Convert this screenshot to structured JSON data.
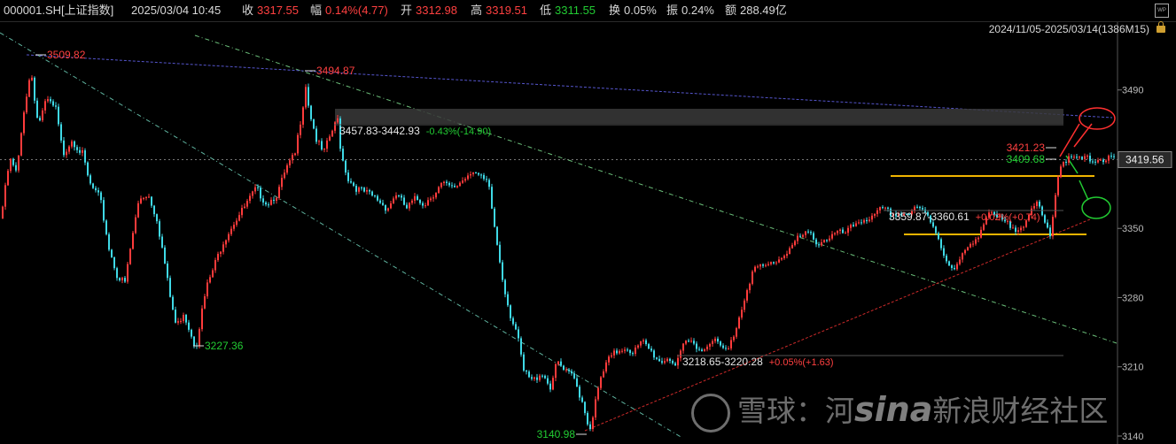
{
  "header": {
    "symbol": "000001.SH[上证指数]",
    "datetime": "2025/03/04 10:45",
    "close_label": "收",
    "close_value": "3317.55",
    "amp_label": "幅",
    "amp_value": "0.14%(4.77)",
    "open_label": "开",
    "open_value": "3312.98",
    "high_label": "高",
    "high_value": "3319.51",
    "low_label": "低",
    "low_value": "3311.55",
    "turnover_label": "换",
    "turnover_value": "0.05%",
    "swing_label": "振",
    "swing_value": "0.24%",
    "amount_label": "额",
    "amount_value": "288.49亿",
    "range": "2024/11/05-2025/03/14(1386M15)"
  },
  "watermark": {
    "brand1": "雪球：河",
    "brand2": "sina",
    "brand3": "新浪财经社区"
  },
  "colors": {
    "up": "#ff3b3b",
    "down": "#3fd9e6",
    "background": "#000000",
    "channel": "#f0b400"
  },
  "chart_data": {
    "type": "candlestick",
    "interval": "15M",
    "ylim": [
      3140,
      3530
    ],
    "yticks": [
      3140,
      3210,
      3280,
      3350,
      3420,
      3490
    ],
    "current_price": "3419.56",
    "pivots": [
      {
        "label": "3509.82",
        "value": 3509.82,
        "kind": "high"
      },
      {
        "label": "3494.87",
        "value": 3494.87,
        "kind": "high"
      },
      {
        "label": "3227.36",
        "value": 3227.36,
        "kind": "low"
      },
      {
        "label": "3140.98",
        "value": 3140.98,
        "kind": "low"
      },
      {
        "label": "3421.23",
        "value": 3421.23,
        "kind": "high"
      },
      {
        "label": "3409.68",
        "value": 3409.68,
        "kind": "low"
      }
    ],
    "gaps": [
      {
        "range": "3457.83-3442.93",
        "change": "-0.43%(-14.90)",
        "dir": "down"
      },
      {
        "range": "3218.65-3220.28",
        "change": "+0.05%(+1.63)",
        "dir": "up"
      },
      {
        "range": "3359.87-3360.61",
        "change": "+0.02%(+0.74)",
        "dir": "up"
      }
    ],
    "price_path": [
      [
        0,
        3360
      ],
      [
        10,
        3420
      ],
      [
        18,
        3405
      ],
      [
        26,
        3470
      ],
      [
        34,
        3510
      ],
      [
        42,
        3455
      ],
      [
        52,
        3480
      ],
      [
        62,
        3470
      ],
      [
        70,
        3425
      ],
      [
        80,
        3440
      ],
      [
        92,
        3425
      ],
      [
        100,
        3395
      ],
      [
        112,
        3380
      ],
      [
        122,
        3330
      ],
      [
        132,
        3300
      ],
      [
        140,
        3295
      ],
      [
        148,
        3340
      ],
      [
        156,
        3380
      ],
      [
        166,
        3385
      ],
      [
        176,
        3360
      ],
      [
        184,
        3320
      ],
      [
        190,
        3285
      ],
      [
        198,
        3250
      ],
      [
        206,
        3265
      ],
      [
        214,
        3245
      ],
      [
        220,
        3230
      ],
      [
        226,
        3262
      ],
      [
        232,
        3290
      ],
      [
        240,
        3310
      ],
      [
        250,
        3335
      ],
      [
        262,
        3355
      ],
      [
        274,
        3370
      ],
      [
        288,
        3390
      ],
      [
        300,
        3375
      ],
      [
        312,
        3385
      ],
      [
        322,
        3410
      ],
      [
        332,
        3425
      ],
      [
        340,
        3470
      ],
      [
        344,
        3495
      ],
      [
        348,
        3470
      ],
      [
        356,
        3440
      ],
      [
        364,
        3425
      ],
      [
        372,
        3445
      ],
      [
        380,
        3460
      ],
      [
        384,
        3425
      ],
      [
        392,
        3400
      ],
      [
        402,
        3390
      ],
      [
        414,
        3385
      ],
      [
        424,
        3380
      ],
      [
        436,
        3370
      ],
      [
        446,
        3385
      ],
      [
        458,
        3370
      ],
      [
        468,
        3380
      ],
      [
        478,
        3375
      ],
      [
        488,
        3385
      ],
      [
        498,
        3395
      ],
      [
        510,
        3390
      ],
      [
        522,
        3400
      ],
      [
        532,
        3410
      ],
      [
        542,
        3400
      ],
      [
        550,
        3395
      ],
      [
        558,
        3345
      ],
      [
        566,
        3300
      ],
      [
        574,
        3265
      ],
      [
        582,
        3245
      ],
      [
        590,
        3205
      ],
      [
        600,
        3195
      ],
      [
        610,
        3205
      ],
      [
        620,
        3190
      ],
      [
        628,
        3215
      ],
      [
        636,
        3205
      ],
      [
        646,
        3200
      ],
      [
        652,
        3185
      ],
      [
        658,
        3170
      ],
      [
        664,
        3145
      ],
      [
        670,
        3170
      ],
      [
        676,
        3195
      ],
      [
        684,
        3215
      ],
      [
        694,
        3225
      ],
      [
        704,
        3230
      ],
      [
        714,
        3225
      ],
      [
        724,
        3235
      ],
      [
        734,
        3225
      ],
      [
        744,
        3215
      ],
      [
        754,
        3220
      ],
      [
        762,
        3210
      ],
      [
        772,
        3235
      ],
      [
        782,
        3235
      ],
      [
        792,
        3225
      ],
      [
        802,
        3240
      ],
      [
        812,
        3230
      ],
      [
        820,
        3225
      ],
      [
        828,
        3245
      ],
      [
        836,
        3270
      ],
      [
        842,
        3290
      ],
      [
        850,
        3310
      ],
      [
        860,
        3310
      ],
      [
        870,
        3315
      ],
      [
        880,
        3320
      ],
      [
        890,
        3330
      ],
      [
        900,
        3340
      ],
      [
        912,
        3345
      ],
      [
        922,
        3335
      ],
      [
        932,
        3340
      ],
      [
        944,
        3345
      ],
      [
        954,
        3345
      ],
      [
        964,
        3355
      ],
      [
        974,
        3360
      ],
      [
        984,
        3360
      ],
      [
        994,
        3370
      ],
      [
        1004,
        3365
      ],
      [
        1014,
        3365
      ],
      [
        1024,
        3365
      ],
      [
        1034,
        3370
      ],
      [
        1044,
        3365
      ],
      [
        1054,
        3350
      ],
      [
        1064,
        3325
      ],
      [
        1074,
        3305
      ],
      [
        1084,
        3320
      ],
      [
        1094,
        3335
      ],
      [
        1104,
        3345
      ],
      [
        1114,
        3365
      ],
      [
        1124,
        3360
      ],
      [
        1134,
        3355
      ],
      [
        1144,
        3350
      ],
      [
        1154,
        3355
      ],
      [
        1162,
        3365
      ],
      [
        1170,
        3375
      ],
      [
        1178,
        3355
      ],
      [
        1184,
        3345
      ],
      [
        1190,
        3385
      ],
      [
        1194,
        3410
      ],
      [
        1200,
        3420
      ]
    ]
  }
}
